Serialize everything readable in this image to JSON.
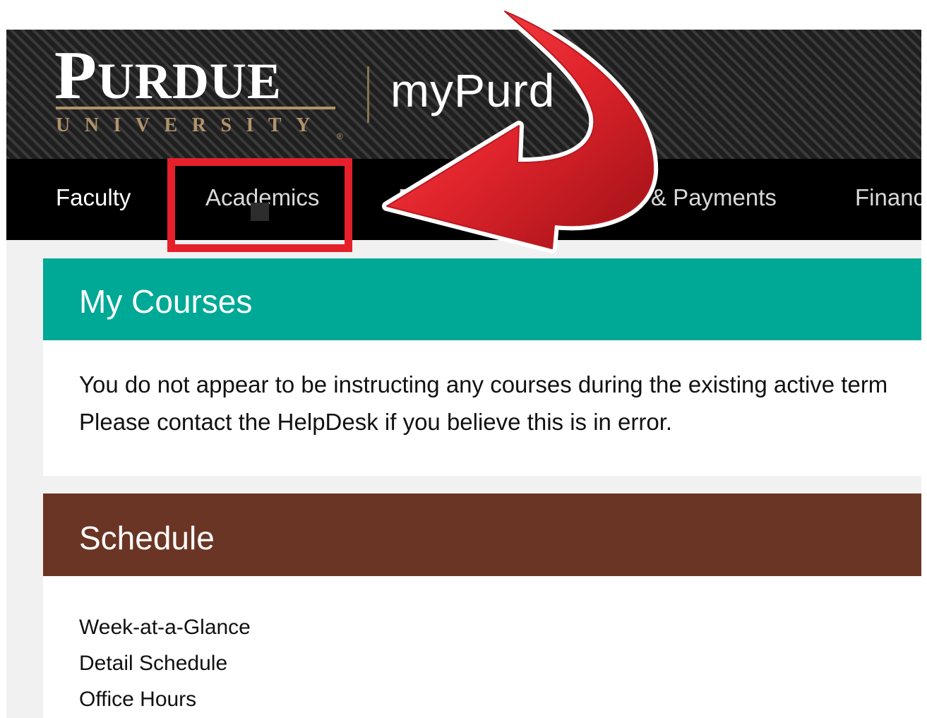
{
  "header": {
    "logo_main_initial": "P",
    "logo_main_rest": "URDUE",
    "logo_sub": "UNIVERSITY",
    "logo_registered": "®",
    "app_title": "myPurd"
  },
  "nav": {
    "items": [
      {
        "label": "Faculty"
      },
      {
        "label": "Academics"
      },
      {
        "label": "R"
      },
      {
        "label": "& Payments"
      },
      {
        "label": "Financ"
      }
    ]
  },
  "courses": {
    "title": "My Courses",
    "message_line1": "You do not appear to be instructing any courses during the existing active term",
    "message_line2": "Please contact the HelpDesk if you believe this is in error."
  },
  "schedule": {
    "title": "Schedule",
    "links": [
      {
        "label": "Week-at-a-Glance"
      },
      {
        "label": "Detail Schedule"
      },
      {
        "label": "Office Hours"
      }
    ]
  },
  "colors": {
    "courses_header": "#00a896",
    "schedule_header": "#6a3524",
    "annotation_red": "#e5202a",
    "purdue_gold": "#b1946c"
  },
  "annotation": {
    "highlighted_item": "Academics",
    "pointer": "arrow-icon"
  }
}
